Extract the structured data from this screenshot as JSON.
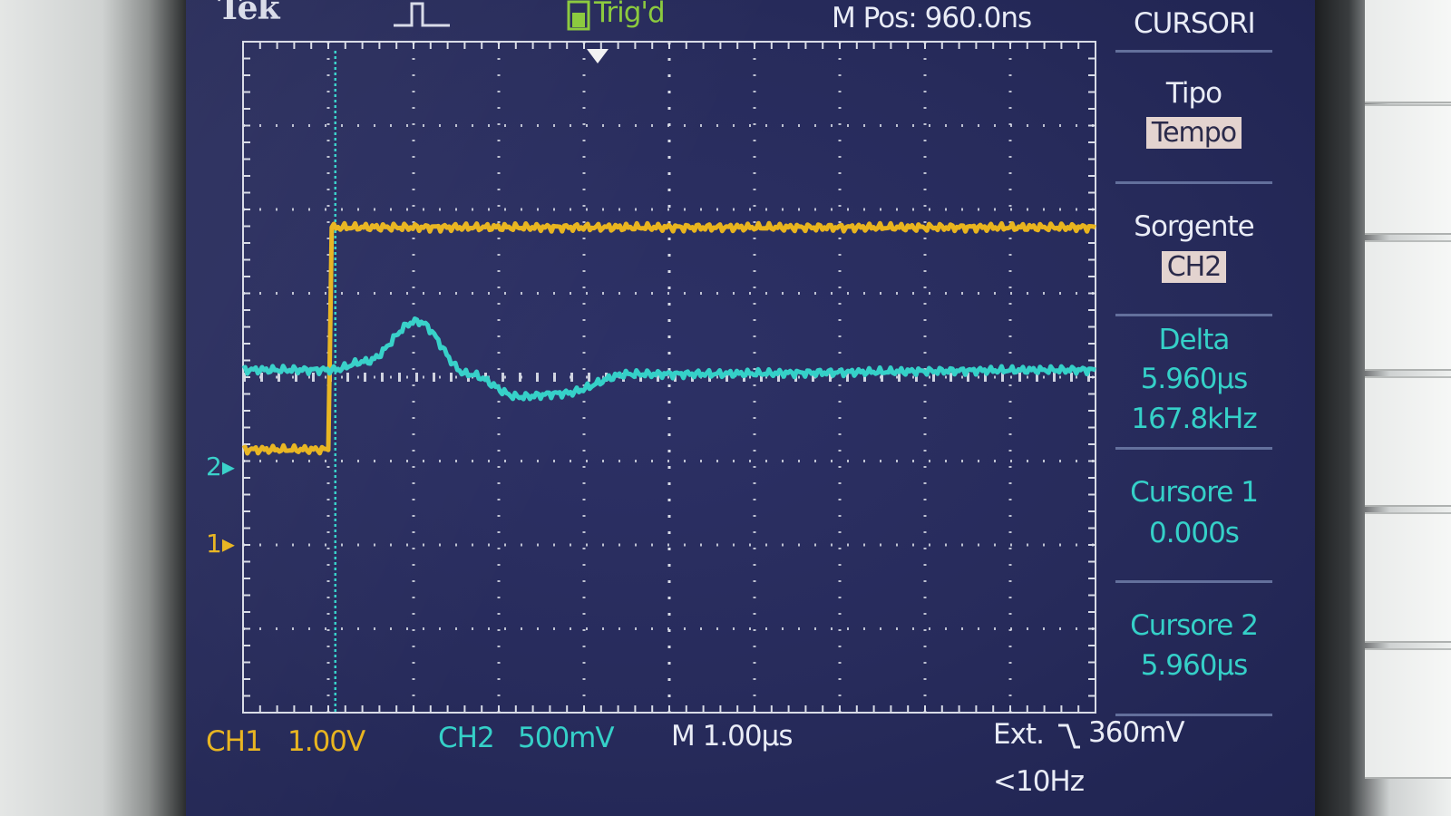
{
  "header": {
    "brand": "Tek",
    "trigger_status": "Trig'd",
    "m_pos": "M Pos: 960.0ns",
    "menu_title": "CURSORI"
  },
  "menu": {
    "tipo_label": "Tipo",
    "tipo_value": "Tempo",
    "sorgente_label": "Sorgente",
    "sorgente_value": "CH2",
    "delta_label": "Delta",
    "delta_time": "5.960µs",
    "delta_freq": "167.8kHz",
    "cursor1_label": "Cursore 1",
    "cursor1_value": "0.000s",
    "cursor2_label": "Cursore 2",
    "cursor2_value": "5.960µs"
  },
  "status_bar": {
    "ch1_name": "CH1",
    "ch1_scale": "1.00V",
    "ch2_name": "CH2",
    "ch2_scale": "500mV",
    "timebase": "M 1.00µs",
    "trigger_source": "Ext.",
    "trigger_level": "360mV",
    "trigger_freq": "<10Hz"
  },
  "channel_markers": {
    "ch1": "1",
    "ch2": "2"
  },
  "colors": {
    "ch1": "#e8b41e",
    "ch2": "#35d0c8",
    "screen": "#2a2e61",
    "grid": "#d8dbe6"
  },
  "chart_data": {
    "type": "line",
    "xlabel": "",
    "ylabel": "",
    "x_unit": "µs",
    "timebase_us_per_div": 1.0,
    "x_range_us": [
      -1.04,
      8.96
    ],
    "grid": true,
    "series": [
      {
        "name": "CH1",
        "volts_per_div": 1.0,
        "x_us": [
          -1.04,
          -0.04,
          0.0,
          8.96
        ],
        "y_div": [
          -0.95,
          -0.95,
          1.7,
          1.7
        ]
      },
      {
        "name": "CH2",
        "volts_per_div": 0.5,
        "x_us": [
          -1.04,
          0.0,
          0.4,
          1.0,
          1.6,
          2.2,
          2.7,
          3.5,
          8.96
        ],
        "y_div": [
          0.0,
          0.0,
          0.1,
          0.58,
          -0.05,
          -0.32,
          -0.28,
          -0.05,
          0.0
        ]
      }
    ]
  }
}
